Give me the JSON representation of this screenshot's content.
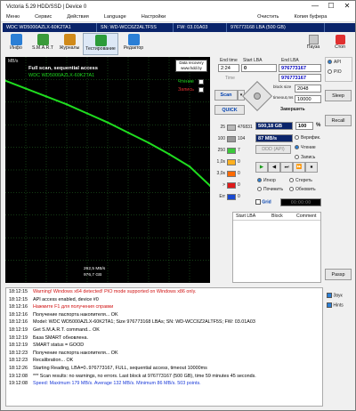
{
  "window": {
    "title": "Victoria 5.29 HDD/SSD | Device 0",
    "minimize": "—",
    "maximize": "☐",
    "close": "✕"
  },
  "menu": [
    "Меню",
    "Сервис",
    "Действия",
    "Language",
    "Настройки",
    "Очистить",
    "Копия буфера"
  ],
  "device_bar": {
    "model": "WDC WD5000AZLX-60K2TA1",
    "serial": "SN: WD-WCC6Z2ALTF5S",
    "firmware": "FW: 03.01A03",
    "lba": "976773168 LBA (500 GB)"
  },
  "toolbar": {
    "items": [
      {
        "label": "Инфо",
        "icon": "info-icon",
        "color": "#2b7fd6"
      },
      {
        "label": "S.M.A.R.T",
        "icon": "smart-icon",
        "color": "#3a9a3a"
      },
      {
        "label": "Журналы",
        "icon": "journal-icon",
        "color": "#d08a1a"
      },
      {
        "label": "Тестирование",
        "icon": "test-icon",
        "color": "#2c9b3a"
      },
      {
        "label": "Редактор",
        "icon": "editor-icon",
        "color": "#2b7fd6"
      }
    ],
    "pause": "Пауза",
    "stop": "Стоп"
  },
  "graph": {
    "speed_unit": "MB/s",
    "title": "Full scan, sequential access",
    "device": "WDC WD5000AZLX-60K2TA1",
    "badge_line1": "Data recovery",
    "badge_line2": "www.hdd.by",
    "cb_read_label": "Чтение",
    "cb_write_label": "Запись",
    "current_speed": "262,5 MB/s",
    "current_lba": "976,7 GB"
  },
  "chart_data": {
    "type": "line",
    "title": "Full scan, sequential access",
    "xlabel": "",
    "ylabel": "MB/s",
    "xlim": [
      0,
      500
    ],
    "ylim": [
      0,
      200
    ],
    "series": [
      {
        "name": "Чтение",
        "x": [
          0,
          50,
          100,
          150,
          200,
          250,
          300,
          350,
          400,
          450,
          500
        ],
        "values": [
          179,
          172,
          165,
          158,
          150,
          142,
          133,
          124,
          114,
          103,
          86
        ]
      }
    ],
    "grid": true,
    "colors": {
      "line": "#1fdc1f",
      "grid": "#2a7a2a",
      "bg": "#000000"
    }
  },
  "controls": {
    "end_time_label": "End time",
    "end_time_value": "2:24",
    "time_label": "Time",
    "start_lba_label": "Start LBA",
    "start_lba_value": "0",
    "end_lba_label": "End LBA",
    "end_lba_value": "976773167",
    "end_lba_value2": "976773167",
    "block_size_label": "block size",
    "block_size_value": "2048",
    "timeout_label": "timeout,ms",
    "timeout_value": "10000",
    "scan_button": "Scan",
    "quick_button": "QUICK",
    "done_label": "Завершить",
    "api_label": "API",
    "pio_label": "PIO",
    "sleep_button": "Sleep",
    "recall_button": "Recall",
    "size_value": "500,18 GB",
    "percent_value": "100",
    "percent_sign": "%",
    "speed_value": "87 MB/s",
    "verify_label": "Верифик.",
    "read_label": "Чтение",
    "write_label": "Запись",
    "ddd_label": "DDD (API)",
    "ignore_label": "Игнор",
    "erase_label": "Стереть",
    "remap_label": "Починить",
    "refresh_label": "Обновить",
    "grid_label": "Grid",
    "timer_value": "00:00:00",
    "table_headers": [
      "Start LBA",
      "Block",
      "Comment"
    ],
    "passp_button": "Passp"
  },
  "blocks": [
    {
      "ms": "25",
      "count": "476831",
      "color": "#b8b8b8"
    },
    {
      "ms": "100",
      "count": "104",
      "color": "#9a9a9a"
    },
    {
      "ms": "250",
      "count": "7",
      "color": "#3ac83a"
    },
    {
      "ms": "1,0s",
      "count": "0",
      "color": "#ffb020"
    },
    {
      "ms": "3,0s",
      "count": "0",
      "color": "#ff6a00"
    },
    {
      "ms": ">",
      "count": "0",
      "color": "#e01a1a"
    },
    {
      "ms": "Err",
      "count": "0",
      "color": "#1a4ad0"
    }
  ],
  "side": {
    "sound_label": "Звук",
    "hints_label": "Hints"
  },
  "log": [
    {
      "time": "18:12:15",
      "msg": "Warning! Windows x64 detected! PIO mode supported on Windows x86 only.",
      "color": "#d01010"
    },
    {
      "time": "18:12:15",
      "msg": "API access enabled, device #0",
      "color": "#000000"
    },
    {
      "time": "18:12:16",
      "msg": "Нажмите F1 для получения справки",
      "color": "#d01010"
    },
    {
      "time": "18:12:16",
      "msg": "Получение паспорта накопителя... OK",
      "color": "#000000"
    },
    {
      "time": "18:12:16",
      "msg": "Model: WDC WD5000AZLX-60K2TA1; Size 976773168 LBAs; SN: WD-WCC6Z2ALTF5S; FW: 03.01A03",
      "color": "#000000"
    },
    {
      "time": "18:12:19",
      "msg": "Get S.M.A.R.T. command... OK",
      "color": "#000000"
    },
    {
      "time": "18:12:19",
      "msg": "База SMART обновлена.",
      "color": "#000000"
    },
    {
      "time": "18:12:19",
      "msg": "SMART status = GOOD",
      "color": "#000000"
    },
    {
      "time": "18:12:23",
      "msg": "Получение паспорта накопителя... OK",
      "color": "#000000"
    },
    {
      "time": "18:12:23",
      "msg": "Recalibration... OK",
      "color": "#000000"
    },
    {
      "time": "18:12:26",
      "msg": "Starting Reading, LBA=0..976773167, FULL, sequential access, timeout 10000ms",
      "color": "#000000"
    },
    {
      "time": "19:12:08",
      "msg": "*** Scan results: no warnings, no errors. Last block at 976773167 (500 GB), time 59 minutes 45 seconds.",
      "color": "#000000"
    },
    {
      "time": "19:12:08",
      "msg": "Speed: Maximum 179 MB/s. Average 132 MB/s. Minimum 86 MB/s. 503 points.",
      "color": "#1a3ad8"
    }
  ]
}
